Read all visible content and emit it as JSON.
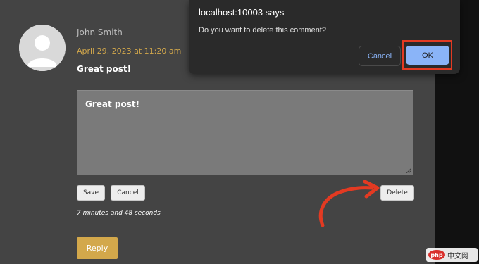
{
  "comment": {
    "author": "John Smith",
    "date": "April 29, 2023 at 11:20 am",
    "text": "Great post!"
  },
  "editor": {
    "value": "Great post!",
    "save_label": "Save",
    "cancel_label": "Cancel",
    "delete_label": "Delete",
    "elapsed": "7 minutes and 48 seconds"
  },
  "reply_label": "Reply",
  "dialog": {
    "title": "localhost:10003 says",
    "message": "Do you want to delete this comment?",
    "cancel_label": "Cancel",
    "ok_label": "OK"
  },
  "watermark": {
    "badge": "php",
    "text": "中文网"
  },
  "colors": {
    "accent": "#d3a84b",
    "dialog_ok": "#8ab4f8",
    "annotation": "#e33a22"
  }
}
